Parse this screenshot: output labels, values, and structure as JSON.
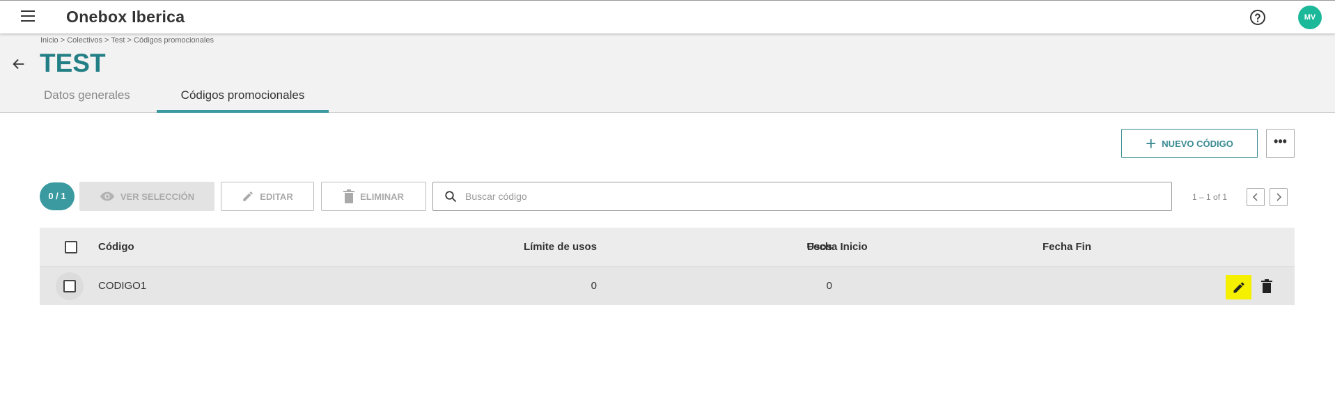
{
  "app": {
    "title": "Onebox Iberica",
    "avatar_initials": "MV"
  },
  "breadcrumb": "Inicio > Colectivos > Test > Códigos promocionales",
  "page": {
    "title": "TEST"
  },
  "tabs": [
    {
      "label": "Datos generales",
      "active": false
    },
    {
      "label": "Códigos promocionales",
      "active": true
    }
  ],
  "actions": {
    "new_code_label": "NUEVO CÓDIGO",
    "more_label": "•••"
  },
  "toolbar": {
    "selection_count": "0 / 1",
    "view_selection_label": "VER SELECCIÓN",
    "edit_label": "EDITAR",
    "delete_label": "ELIMINAR",
    "search_placeholder": "Buscar código",
    "pagination": "1 – 1 of 1"
  },
  "table": {
    "columns": [
      "Código",
      "Límite de usos",
      "Usos",
      "Fecha Inicio",
      "Fecha Fin"
    ],
    "rows": [
      {
        "code": "CODIGO1",
        "limit": "0",
        "uses": "0",
        "start": "",
        "end": ""
      }
    ]
  },
  "colors": {
    "accent": "#237f86",
    "teal": "#3a9aa0",
    "avatar": "#1bb89a",
    "highlight": "#f5ef00"
  },
  "icons": [
    "menu-icon",
    "help-icon",
    "back-arrow-icon",
    "plus-icon",
    "eye-icon",
    "pencil-icon",
    "trash-icon",
    "search-icon",
    "chevron-left-icon",
    "chevron-right-icon"
  ]
}
